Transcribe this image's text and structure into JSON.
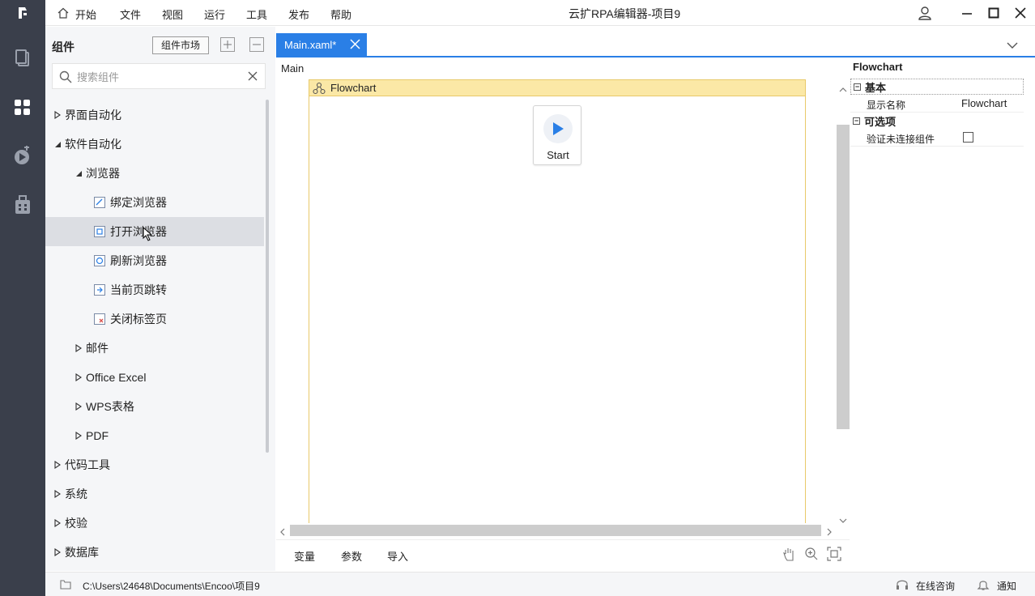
{
  "window": {
    "title": "云扩RPA编辑器-项目9"
  },
  "menu": {
    "home": "开始",
    "file": "文件",
    "view": "视图",
    "run": "运行",
    "tools": "工具",
    "publish": "发布",
    "help": "帮助"
  },
  "panel": {
    "title": "组件",
    "market_button": "组件市场",
    "search_placeholder": "搜索组件",
    "tree": [
      {
        "label": "界面自动化"
      },
      {
        "label": "软件自动化"
      },
      {
        "label": "浏览器"
      },
      {
        "label": "绑定浏览器"
      },
      {
        "label": "打开浏览器"
      },
      {
        "label": "刷新浏览器"
      },
      {
        "label": "当前页跳转"
      },
      {
        "label": "关闭标签页"
      },
      {
        "label": "邮件"
      },
      {
        "label": "Office Excel"
      },
      {
        "label": "WPS表格"
      },
      {
        "label": "PDF"
      },
      {
        "label": "代码工具"
      },
      {
        "label": "系统"
      },
      {
        "label": "校验"
      },
      {
        "label": "数据库"
      }
    ]
  },
  "editor": {
    "tab_label": "Main.xaml*",
    "breadcrumb": "Main",
    "flowchart_label": "Flowchart",
    "start_label": "Start"
  },
  "bottom_tabs": {
    "variables": "变量",
    "arguments": "参数",
    "imports": "导入"
  },
  "properties": {
    "title": "Flowchart",
    "cat_basic": "基本",
    "display_name_key": "显示名称",
    "display_name_value": "Flowchart",
    "cat_optional": "可选项",
    "validate_key": "验证未连接组件",
    "validate_checked": false
  },
  "status": {
    "path": "C:\\Users\\24648\\Documents\\Encoo\\项目9",
    "consult": "在线咨询",
    "notify": "通知"
  },
  "colors": {
    "rail": "#3a3f4b",
    "accent": "#2a7fe6",
    "flowchart_header": "#fbe8a6"
  }
}
